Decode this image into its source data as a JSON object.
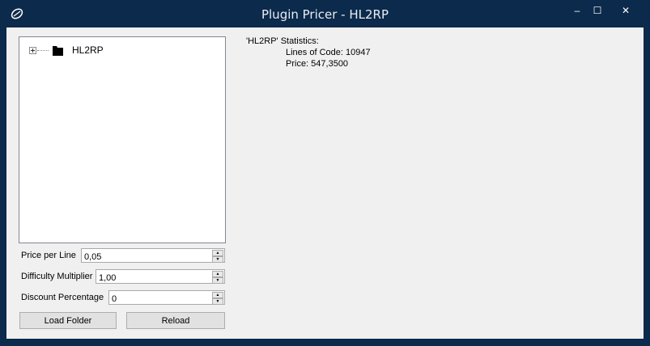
{
  "window": {
    "title": "Plugin Pricer - HL2RP",
    "minimize": "–",
    "maximize": "☐",
    "close": "✕"
  },
  "tree": {
    "nodes": [
      {
        "label": "HL2RP"
      }
    ]
  },
  "stats": {
    "heading": "'HL2RP' Statistics:",
    "lines_of_code": "Lines of Code: 10947",
    "price": "Price: 547,3500"
  },
  "fields": {
    "price_per_line": {
      "label": "Price per Line",
      "value": "0,05"
    },
    "difficulty_multiplier": {
      "label": "Difficulty Multiplier",
      "value": "1,00"
    },
    "discount_percentage": {
      "label": "Discount Percentage",
      "value": "0"
    }
  },
  "buttons": {
    "load_folder": "Load Folder",
    "reload": "Reload"
  },
  "colors": {
    "titlebar": "#0c2a4b",
    "client_bg": "#f0f0f0"
  }
}
